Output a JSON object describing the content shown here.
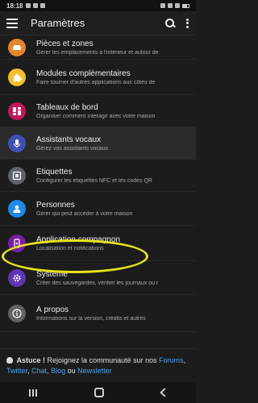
{
  "status_bar": {
    "time": "18:18"
  },
  "app_bar": {
    "title": "Paramètres"
  },
  "items": [
    {
      "title": "Pièces et zones",
      "subtitle": "Gérer les emplacements à l'intérieur et autour de",
      "color": "#e3862d",
      "icon": "sofa-icon"
    },
    {
      "title": "Modules complémentaires",
      "subtitle": "Faire tourner d'autres applications aux côtés de",
      "color": "#f2c02f",
      "icon": "puzzle-icon"
    },
    {
      "title": "Tableaux de bord",
      "subtitle": "Organiser comment interagir avec votre maison",
      "color": "#c2185b",
      "icon": "dashboard-icon"
    },
    {
      "title": "Assistants vocaux",
      "subtitle": "Gérez vos assistants vocaux",
      "color": "#3f51b5",
      "icon": "microphone-icon"
    },
    {
      "title": "Étiquettes",
      "subtitle": "Configurer les étiquettes NFC et les codes QR",
      "color": "#5f6368",
      "icon": "nfc-icon"
    },
    {
      "title": "Personnes",
      "subtitle": "Gérer qui peut accéder à votre maison",
      "color": "#1e88e5",
      "icon": "person-icon"
    },
    {
      "title": "Application compagnon",
      "subtitle": "Localisation et notifications",
      "color": "#7b1fa2",
      "icon": "cellphone-icon"
    },
    {
      "title": "Système",
      "subtitle": "Créer des sauvegardes, vérifier les journaux ou r",
      "color": "#5e35b1",
      "icon": "gear-icon"
    },
    {
      "title": "À propos",
      "subtitle": "Informations sur la version, crédits et autres",
      "color": "#616161",
      "icon": "info-icon"
    }
  ],
  "tip": {
    "label": "Astuce !",
    "text_before": " Rejoignez la communauté sur nos ",
    "forums": "Forums",
    "sep1": ",",
    "twitter": "Twitter",
    "sep2": ", ",
    "chat": "Chat",
    "sep3": ", ",
    "blog": "Blog",
    "text_ou": " ou ",
    "newsletter": "Newsletter"
  },
  "annotation_color": "#e8e31a"
}
